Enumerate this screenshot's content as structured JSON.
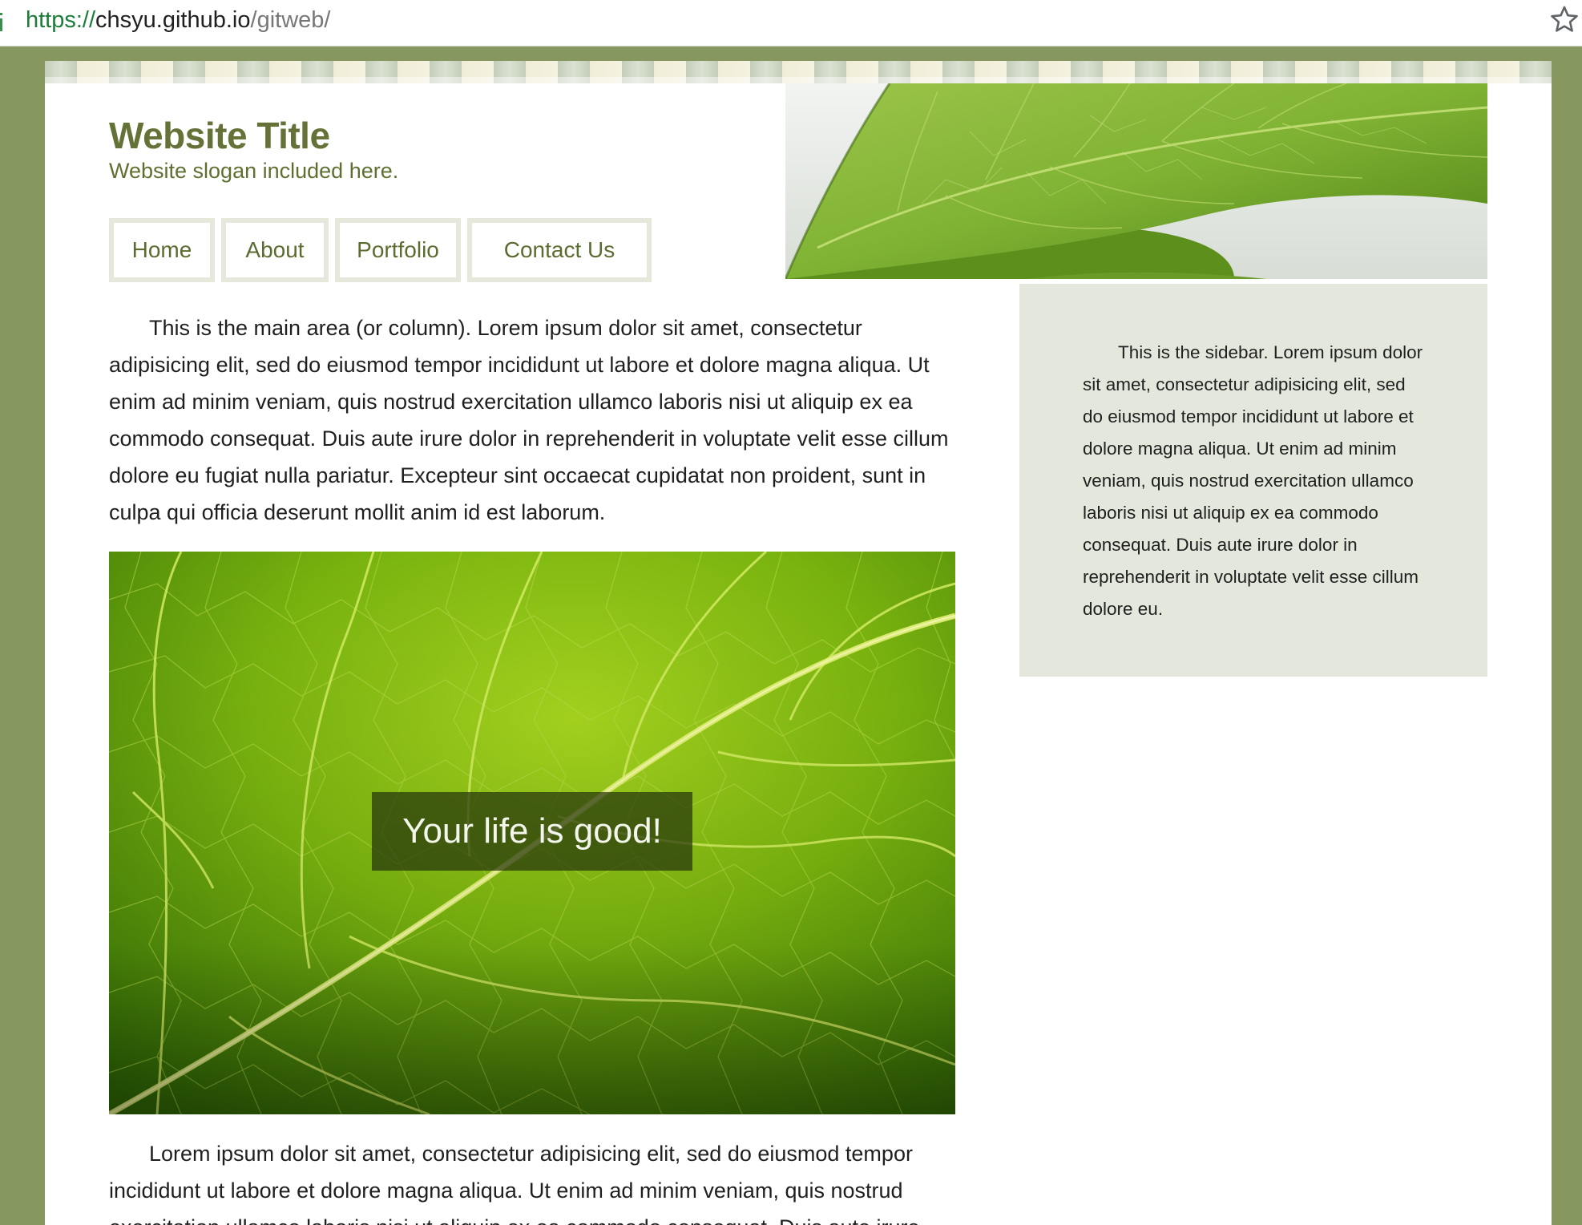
{
  "browser": {
    "url_scheme": "https://",
    "url_host": "chsyu.github.io",
    "url_path": "/gitweb/"
  },
  "header": {
    "title": "Website Title",
    "slogan": "Website slogan included here."
  },
  "nav": {
    "items": [
      {
        "label": "Home"
      },
      {
        "label": "About"
      },
      {
        "label": "Portfolio"
      },
      {
        "label": "Contact Us"
      }
    ]
  },
  "main": {
    "intro": "This is the main area (or column). Lorem ipsum dolor sit amet, consectetur adipisicing elit, sed do eiusmod tempor incididunt ut labore et dolore magna aliqua. Ut enim ad minim veniam, quis nostrud exercitation ullamco laboris nisi ut aliquip ex ea commodo consequat. Duis aute irure dolor in reprehenderit in voluptate velit esse cillum dolore eu fugiat nulla pariatur. Excepteur sint occaecat cupidatat non proident, sunt in culpa qui officia deserunt mollit anim id est laborum.",
    "image_caption": "Your life is good!",
    "outro": "Lorem ipsum dolor sit amet, consectetur adipisicing elit, sed do eiusmod tempor incididunt ut labore et dolore magna aliqua. Ut enim ad minim veniam, quis nostrud exercitation ullamco laboris nisi ut aliquip ex ea commodo consequat. Duis aute irure"
  },
  "sidebar": {
    "text": "This is the sidebar. Lorem ipsum dolor sit amet, consectetur adipisicing elit, sed do eiusmod tempor incididunt ut labore et dolore magna aliqua. Ut enim ad minim veniam, quis nostrud exercitation ullamco laboris nisi ut aliquip ex ea commodo consequat. Duis aute irure dolor in reprehenderit in voluptate velit esse cillum dolore eu."
  },
  "colors": {
    "page_background": "#869760",
    "title": "#647237",
    "nav_text": "#5a6c2f",
    "nav_border": "#e6e8dc",
    "sidebar_background": "#e4e8dc"
  }
}
